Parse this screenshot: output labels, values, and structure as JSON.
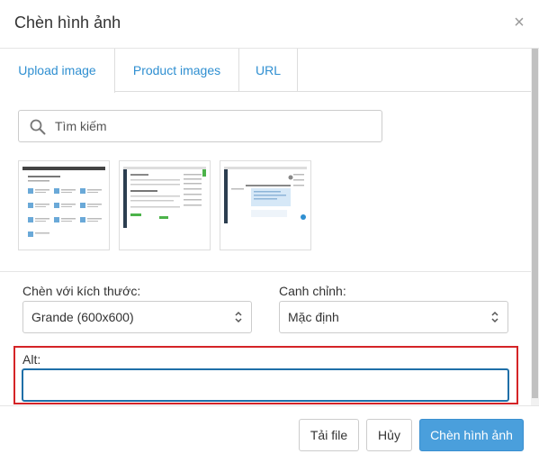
{
  "dialog": {
    "title": "Chèn hình ảnh",
    "close_icon": "close-icon",
    "close_glyph": "×"
  },
  "tabs": [
    {
      "label": "Upload image",
      "active": true
    },
    {
      "label": "Product images",
      "active": false
    },
    {
      "label": "URL",
      "active": false
    }
  ],
  "search": {
    "placeholder": "Tìm kiếm",
    "value": "",
    "icon": "search-icon"
  },
  "images": [
    {
      "icon": "image-thumbnail"
    },
    {
      "icon": "image-thumbnail"
    },
    {
      "icon": "image-thumbnail"
    }
  ],
  "size": {
    "label": "Chèn với kích thước:",
    "selected": "Grande (600x600)"
  },
  "alignment": {
    "label": "Canh chỉnh:",
    "selected": "Mặc định"
  },
  "alt": {
    "label": "Alt:",
    "value": ""
  },
  "footer": {
    "upload_label": "Tải file",
    "cancel_label": "Hủy",
    "insert_label": "Chèn hình ảnh"
  },
  "colors": {
    "accent": "#2f8fd1",
    "primary_button": "#4a9fdc",
    "highlight_border": "#d42427"
  }
}
